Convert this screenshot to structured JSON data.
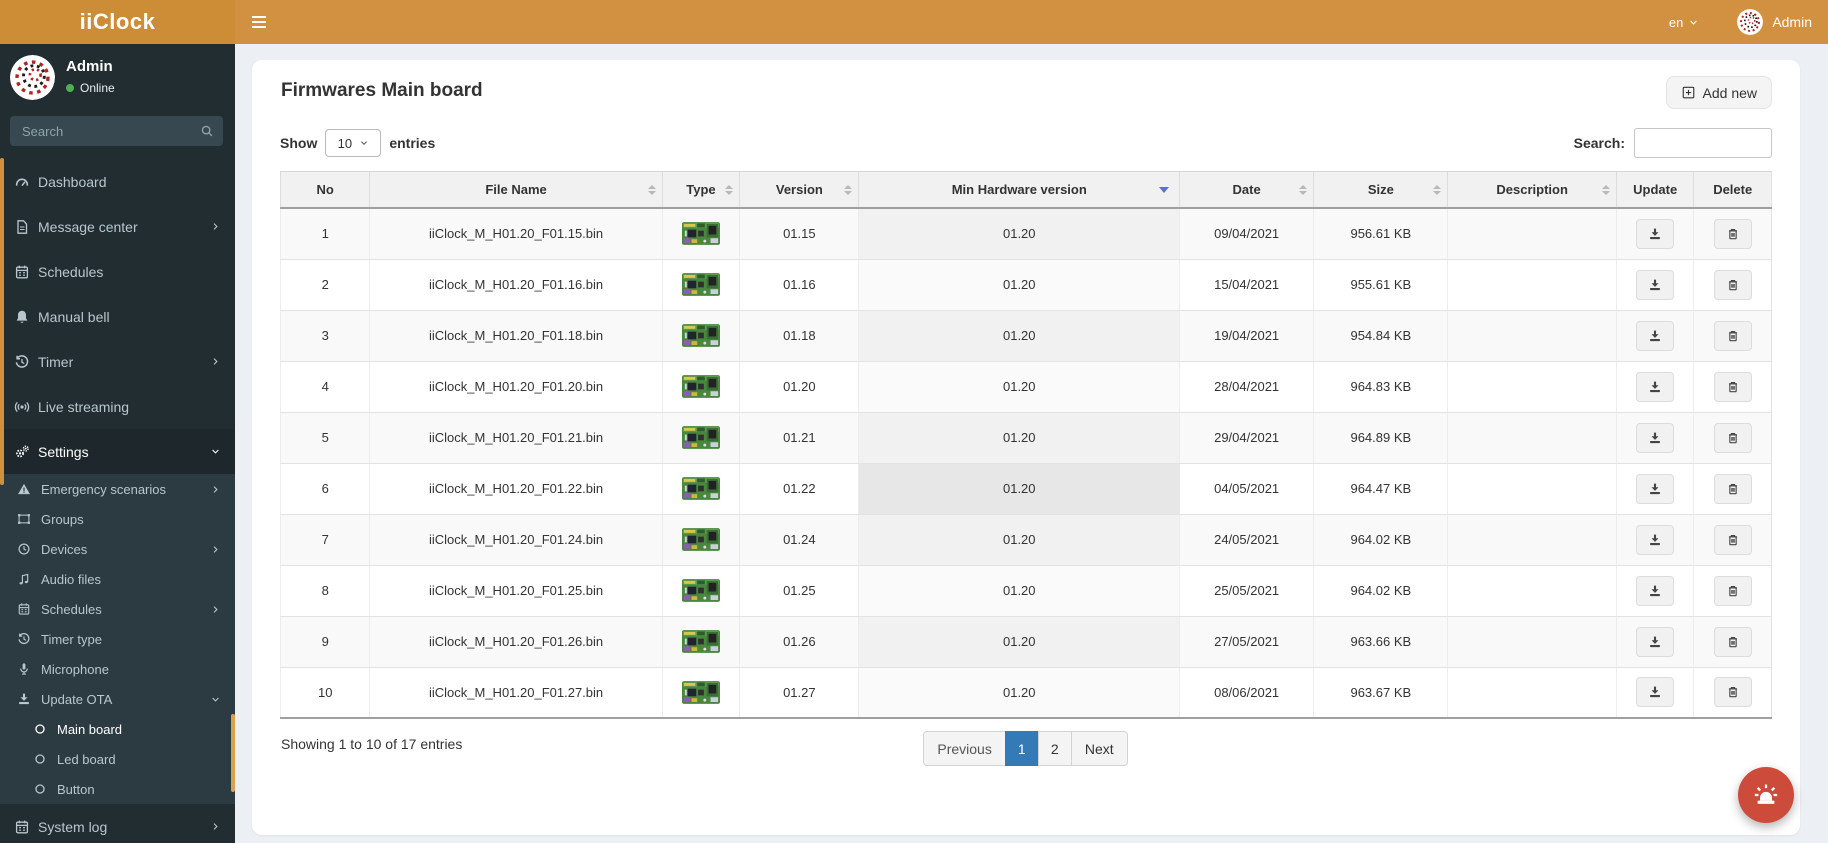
{
  "colors": {
    "topbar_orange": "#d19140",
    "brand_orange": "#cd8d37",
    "sidebar_bg": "#222d32",
    "submenu_bg": "#2c3b41",
    "active_accent": "#d0903c",
    "online_dot": "#4caf50",
    "pagination_active": "#337ab7",
    "sort_active_triangle": "#5e70cc",
    "fab_red": "#cc4b3b"
  },
  "topbar": {
    "brand": "iiClock",
    "menu_icon": "hamburger-icon",
    "language": "en",
    "user": "Admin"
  },
  "sidebar": {
    "user_name": "Admin",
    "user_status": "Online",
    "search_placeholder": "Search",
    "search_icon": "search-icon",
    "menu": [
      {
        "id": "dashboard",
        "icon": "gauge-icon",
        "label": "Dashboard",
        "level": 1
      },
      {
        "id": "message-center",
        "icon": "file-icon",
        "label": "Message center",
        "level": 1,
        "chevron": "right"
      },
      {
        "id": "schedules",
        "icon": "calendar-icon",
        "label": "Schedules",
        "level": 1
      },
      {
        "id": "manual-bell",
        "icon": "bell-icon",
        "label": "Manual bell",
        "level": 1
      },
      {
        "id": "timer",
        "icon": "history-icon",
        "label": "Timer",
        "level": 1,
        "chevron": "right"
      },
      {
        "id": "live-streaming",
        "icon": "broadcast-icon",
        "label": "Live streaming",
        "level": 1
      },
      {
        "id": "settings",
        "icon": "gears-icon",
        "label": "Settings",
        "level": 1,
        "chevron": "down",
        "active": true
      },
      {
        "id": "emergency-scenarios",
        "icon": "warning-icon",
        "label": "Emergency scenarios",
        "level": 2,
        "chevron": "right"
      },
      {
        "id": "groups",
        "icon": "object-group-icon",
        "label": "Groups",
        "level": 2
      },
      {
        "id": "devices",
        "icon": "clock-icon",
        "label": "Devices",
        "level": 2,
        "chevron": "right"
      },
      {
        "id": "audio-files",
        "icon": "music-icon",
        "label": "Audio files",
        "level": 2
      },
      {
        "id": "schedules-settings",
        "icon": "calendar-icon",
        "label": "Schedules",
        "level": 2,
        "chevron": "right"
      },
      {
        "id": "timer-type",
        "icon": "history-icon",
        "label": "Timer type",
        "level": 2
      },
      {
        "id": "microphone",
        "icon": "microphone-icon",
        "label": "Microphone",
        "level": 2
      },
      {
        "id": "update-ota",
        "icon": "download-icon",
        "label": "Update OTA",
        "level": 2,
        "chevron": "down"
      },
      {
        "id": "main-board",
        "icon": "circle-o-icon",
        "label": "Main board",
        "level": 3,
        "active": true
      },
      {
        "id": "led-board",
        "icon": "circle-o-icon",
        "label": "Led board",
        "level": 3
      },
      {
        "id": "button",
        "icon": "circle-o-icon",
        "label": "Button",
        "level": 3
      },
      {
        "id": "system-log",
        "icon": "calendar-icon",
        "label": "System log",
        "level": 1,
        "chevron": "right"
      }
    ]
  },
  "main": {
    "title": "Firmwares Main board",
    "add_new": "Add new",
    "add_new_icon": "plus-square-icon",
    "show_label": "Show",
    "page_length": "10",
    "entries_label": "entries",
    "search_label": "Search:",
    "search_value": "",
    "table": {
      "columns": [
        {
          "label": "No",
          "sort": "none"
        },
        {
          "label": "File Name",
          "sort": "both"
        },
        {
          "label": "Type",
          "sort": "both"
        },
        {
          "label": "Version",
          "sort": "both"
        },
        {
          "label": "Min Hardware version",
          "sort": "desc"
        },
        {
          "label": "Date",
          "sort": "both"
        },
        {
          "label": "Size",
          "sort": "both"
        },
        {
          "label": "Description",
          "sort": "both"
        },
        {
          "label": "Update",
          "sort": "none"
        },
        {
          "label": "Delete",
          "sort": "none"
        }
      ],
      "type_thumbnail": "pcb-thumbnail",
      "update_icon": "download-icon",
      "delete_icon": "trash-icon",
      "highlighted_row": 6,
      "rows": [
        {
          "no": "1",
          "file_name": "iiClock_M_H01.20_F01.15.bin",
          "version": "01.15",
          "min_hw": "01.20",
          "date": "09/04/2021",
          "size": "956.61 KB",
          "description": ""
        },
        {
          "no": "2",
          "file_name": "iiClock_M_H01.20_F01.16.bin",
          "version": "01.16",
          "min_hw": "01.20",
          "date": "15/04/2021",
          "size": "955.61 KB",
          "description": ""
        },
        {
          "no": "3",
          "file_name": "iiClock_M_H01.20_F01.18.bin",
          "version": "01.18",
          "min_hw": "01.20",
          "date": "19/04/2021",
          "size": "954.84 KB",
          "description": ""
        },
        {
          "no": "4",
          "file_name": "iiClock_M_H01.20_F01.20.bin",
          "version": "01.20",
          "min_hw": "01.20",
          "date": "28/04/2021",
          "size": "964.83 KB",
          "description": ""
        },
        {
          "no": "5",
          "file_name": "iiClock_M_H01.20_F01.21.bin",
          "version": "01.21",
          "min_hw": "01.20",
          "date": "29/04/2021",
          "size": "964.89 KB",
          "description": ""
        },
        {
          "no": "6",
          "file_name": "iiClock_M_H01.20_F01.22.bin",
          "version": "01.22",
          "min_hw": "01.20",
          "date": "04/05/2021",
          "size": "964.47 KB",
          "description": ""
        },
        {
          "no": "7",
          "file_name": "iiClock_M_H01.20_F01.24.bin",
          "version": "01.24",
          "min_hw": "01.20",
          "date": "24/05/2021",
          "size": "964.02 KB",
          "description": ""
        },
        {
          "no": "8",
          "file_name": "iiClock_M_H01.20_F01.25.bin",
          "version": "01.25",
          "min_hw": "01.20",
          "date": "25/05/2021",
          "size": "964.02 KB",
          "description": ""
        },
        {
          "no": "9",
          "file_name": "iiClock_M_H01.20_F01.26.bin",
          "version": "01.26",
          "min_hw": "01.20",
          "date": "27/05/2021",
          "size": "963.66 KB",
          "description": ""
        },
        {
          "no": "10",
          "file_name": "iiClock_M_H01.20_F01.27.bin",
          "version": "01.27",
          "min_hw": "01.20",
          "date": "08/06/2021",
          "size": "963.67 KB",
          "description": ""
        }
      ]
    },
    "summary": "Showing 1 to 10 of 17 entries",
    "pagination": {
      "previous": "Previous",
      "pages": [
        "1",
        "2"
      ],
      "active": "1",
      "next": "Next"
    },
    "fab_icon": "siren-icon"
  }
}
